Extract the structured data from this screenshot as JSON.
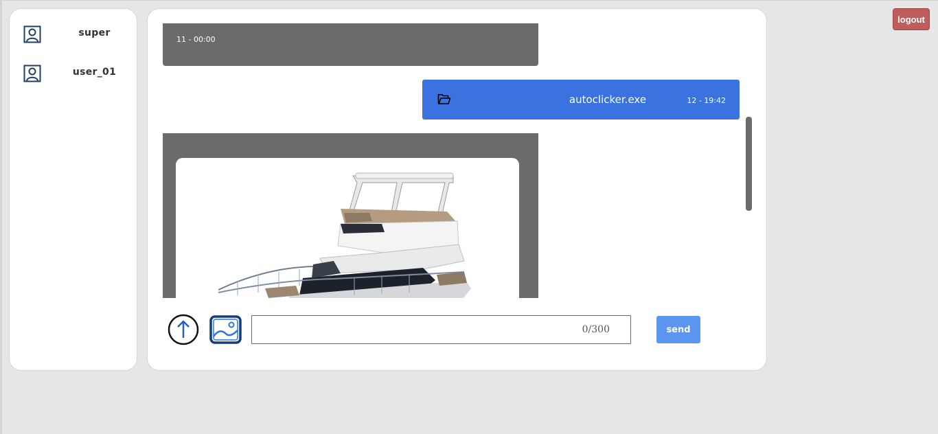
{
  "sidebar": {
    "users": [
      {
        "name": "super",
        "icon": "user-icon"
      },
      {
        "name": "user_01",
        "icon": "user-icon"
      }
    ]
  },
  "messages": [
    {
      "type": "text",
      "timestamp": "11 - 00:00"
    },
    {
      "type": "file",
      "icon": "folder-icon",
      "filename": "autoclicker.exe",
      "timestamp": "12 - 19:42",
      "color": "#3a73e0"
    },
    {
      "type": "image",
      "image": "boat-photo"
    }
  ],
  "composer": {
    "upload_icon": "upload-arrow-icon",
    "image_icon": "image-icon",
    "input_value": "",
    "counter": "0/300",
    "send_label": "send"
  },
  "header": {
    "logout_label": "logout"
  },
  "colors": {
    "accent": "#3a73e0",
    "send": "#5b95ef",
    "logout": "#bf5d5d",
    "bubble_gray": "#6b6b6b",
    "background": "#e6e6e6"
  }
}
